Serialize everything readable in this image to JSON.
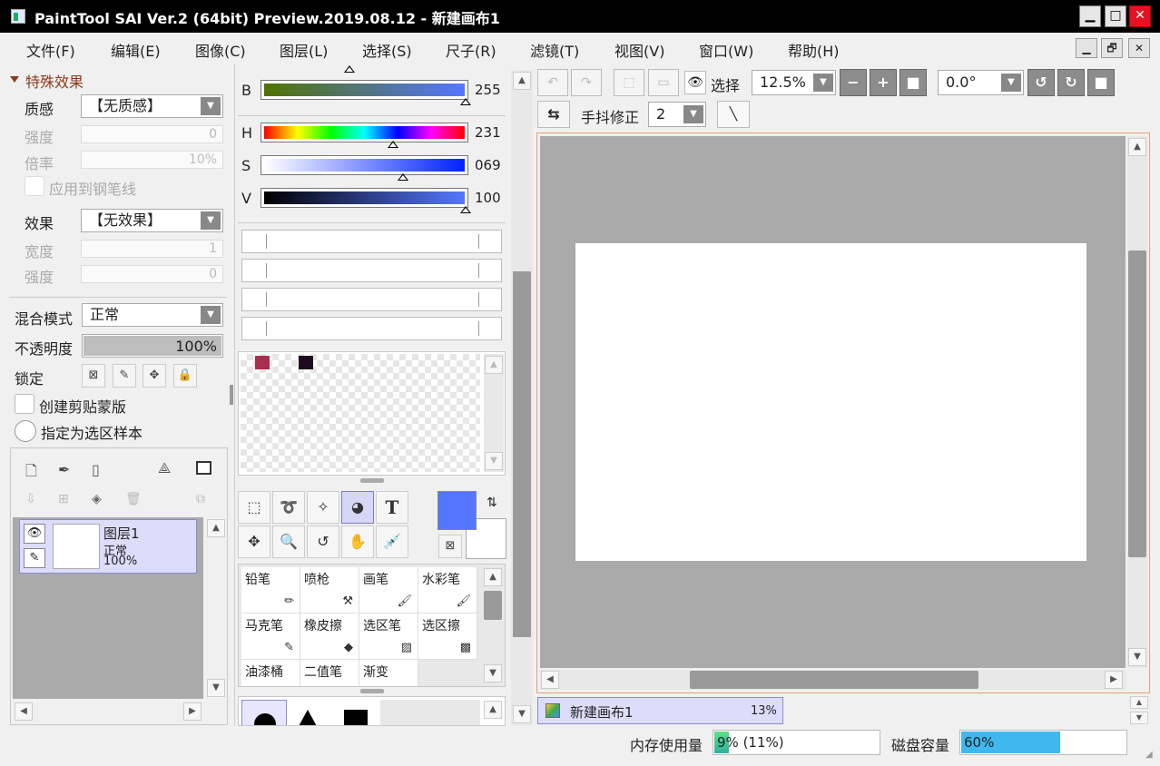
{
  "window": {
    "title": "PaintTool SAI Ver.2 (64bit) Preview.2019.08.12 - 新建画布1",
    "min": "▁",
    "max": "□",
    "close": "✕"
  },
  "menu": [
    "文件(F)",
    "编辑(E)",
    "图像(C)",
    "图层(L)",
    "选择(S)",
    "尺子(R)",
    "滤镜(T)",
    "视图(V)",
    "窗口(W)",
    "帮助(H)"
  ],
  "mdi": {
    "min": "▁",
    "restore": "🗗",
    "close": "✕"
  },
  "effects": {
    "header": "特殊效果",
    "texture_label": "质感",
    "texture_value": "【无质感】",
    "strength_label": "强度",
    "strength_value": "0",
    "scale_label": "倍率",
    "scale_value": "10%",
    "apply_pen_label": "应用到钢笔线",
    "effect_label": "效果",
    "effect_value": "【无效果】",
    "width_label": "宽度",
    "width_value": "1",
    "strength2_label": "强度",
    "strength2_value": "0"
  },
  "layer_props": {
    "blend_label": "混合模式",
    "blend_value": "正常",
    "opacity_label": "不透明度",
    "opacity_value": "100%",
    "opacity_level": 1.0,
    "lock_label": "锁定",
    "clip_label": "创建剪贴蒙版",
    "sample_label": "指定为选区样本"
  },
  "layers": [
    {
      "name": "图层1",
      "mode": "正常",
      "opacity": "100%"
    }
  ],
  "color": {
    "B": {
      "label": "B",
      "value": "255"
    },
    "H": {
      "label": "H",
      "value": "231"
    },
    "S": {
      "label": "S",
      "value": "069"
    },
    "V": {
      "label": "V",
      "value": "100"
    },
    "swatches": [
      "#a8304e",
      "#1f0a1d"
    ],
    "primary": "#5577ff",
    "secondary": "#ffffff"
  },
  "tools": {
    "text_tool": "T"
  },
  "brushes": [
    "铅笔",
    "喷枪",
    "画笔",
    "水彩笔",
    "马克笔",
    "橡皮擦",
    "选区笔",
    "选区擦",
    "油漆桶",
    "二值笔",
    "渐变"
  ],
  "toolbar": {
    "select_label": "选择",
    "zoom": "12.5%",
    "angle": "0.0°",
    "stabilizer_label": "手抖修正",
    "stabilizer_value": "2"
  },
  "canvas_tab": {
    "name": "新建画布1",
    "zoom": "13%"
  },
  "status": {
    "mem_label": "内存使用量",
    "mem_value": "9% (11%)",
    "mem_level": 0.09,
    "disk_label": "磁盘容量",
    "disk_value": "60%",
    "disk_level": 0.6
  }
}
